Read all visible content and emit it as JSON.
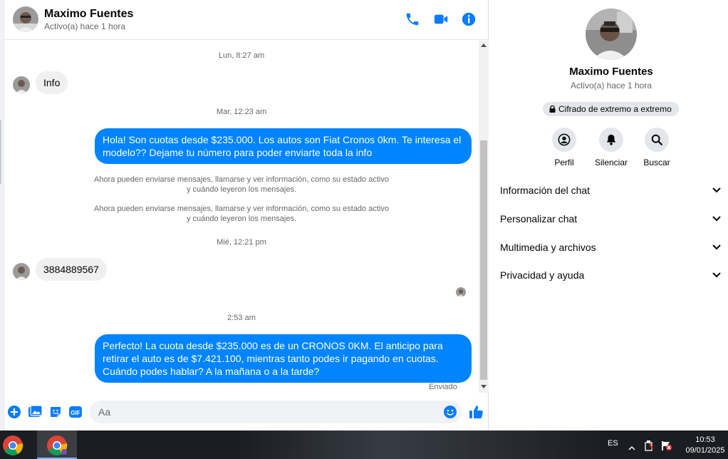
{
  "contact": {
    "name": "Maximo Fuentes",
    "status": "Activo(a) hace 1 hora"
  },
  "header_icons": [
    "phone-icon",
    "video-icon",
    "info-icon"
  ],
  "messages": {
    "ts1": "Lun, 8:27 am",
    "in1": "Info",
    "ts2": "Mar, 12:23 am",
    "out1": "Hola! Son cuotas desde $235.000. Los autos son Fiat Cronos 0km. Te interesa el modelo?? Dejame tu número para poder enviarte toda la info",
    "sys1_line1": "Ahora pueden enviarse mensajes, llamarse y ver información, como su estado activo",
    "sys1_line2": "y cuándo leyeron los mensajes.",
    "sys2_line1": "Ahora pueden enviarse mensajes, llamarse y ver información, como su estado activo",
    "sys2_line2": "y cuándo leyeron los mensajes.",
    "ts3": "Mié, 12:21 pm",
    "in2": "3884889567",
    "ts4": "2:53 am",
    "out2": "Perfecto! La cuota desde $235.000 es de un CRONOS 0KM. El anticipo para retirar el auto es de $7.421.100, mientras tanto podes ir pagando en cuotas. Cuándo podes hablar? A la mañana o a la tarde?",
    "delivered": "Enviado"
  },
  "composer": {
    "placeholder": "Aa",
    "icons": [
      "add-icon",
      "image-icon",
      "sticker-icon",
      "gif-icon",
      "emoji-icon",
      "like-icon"
    ],
    "gif_label": "GIF"
  },
  "info_panel": {
    "name": "Maximo Fuentes",
    "status": "Activo(a) hace 1 hora",
    "encryption": "Cifrado de extremo a extremo",
    "actions": [
      {
        "label": "Perfil",
        "icon": "profile-icon"
      },
      {
        "label": "Silenciar",
        "icon": "bell-icon"
      },
      {
        "label": "Buscar",
        "icon": "search-icon"
      }
    ],
    "sections": [
      "Información del chat",
      "Personalizar chat",
      "Multimedia y archivos",
      "Privacidad y ayuda"
    ]
  },
  "taskbar": {
    "language": "ES",
    "time": "10:53",
    "date": "09/01/2025"
  },
  "colors": {
    "accent": "#0084ff",
    "icon_blue": "#0a7cff"
  }
}
